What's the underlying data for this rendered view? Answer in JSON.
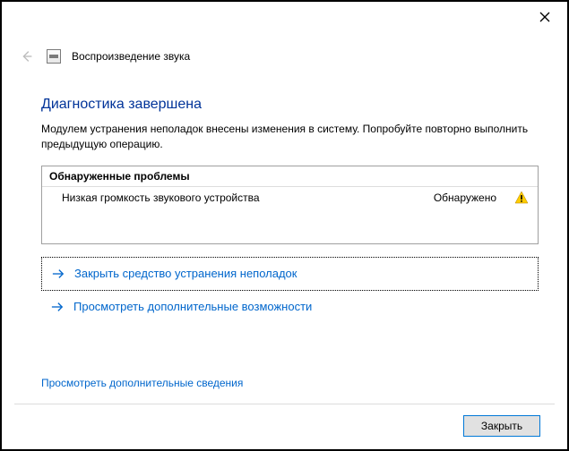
{
  "header": {
    "title": "Воспроизведение звука"
  },
  "main": {
    "heading": "Диагностика завершена",
    "description": "Модулем устранения неполадок внесены изменения в систему. Попробуйте повторно выполнить предыдущую операцию."
  },
  "problems": {
    "header": "Обнаруженные проблемы",
    "items": [
      {
        "name": "Низкая громкость звукового устройства",
        "status": "Обнаружено"
      }
    ]
  },
  "options": {
    "close_troubleshooter": "Закрыть средство устранения неполадок",
    "explore_more": "Просмотреть дополнительные возможности"
  },
  "links": {
    "view_details": "Просмотреть дополнительные сведения"
  },
  "footer": {
    "close": "Закрыть"
  }
}
